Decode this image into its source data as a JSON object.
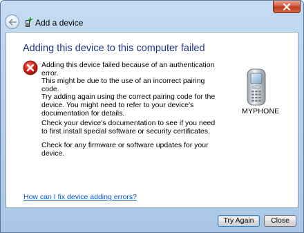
{
  "window": {
    "close_symbol": "✕"
  },
  "header": {
    "title": "Add a device",
    "back_icon": "back-arrow-icon",
    "app_icon": "add-device-icon"
  },
  "main": {
    "heading": "Adding this device to this computer failed",
    "status_icon": "error-icon",
    "messages": [
      "Adding this device failed because of an authentication error.",
      "This might be due to the use of an incorrect pairing code.",
      "Try adding again using the correct pairing code for the device. You might need to refer to your device's documentation for details.",
      "Check your device's documentation to see if you need to first install special software or security certificates.",
      "Check for any firmware or software updates for your device."
    ],
    "device": {
      "icon": "mobile-phone-icon",
      "name": "MYPHONE"
    },
    "help_link": "How can I fix device adding errors?"
  },
  "footer": {
    "try_again_label": "Try Again",
    "close_label": "Close"
  }
}
